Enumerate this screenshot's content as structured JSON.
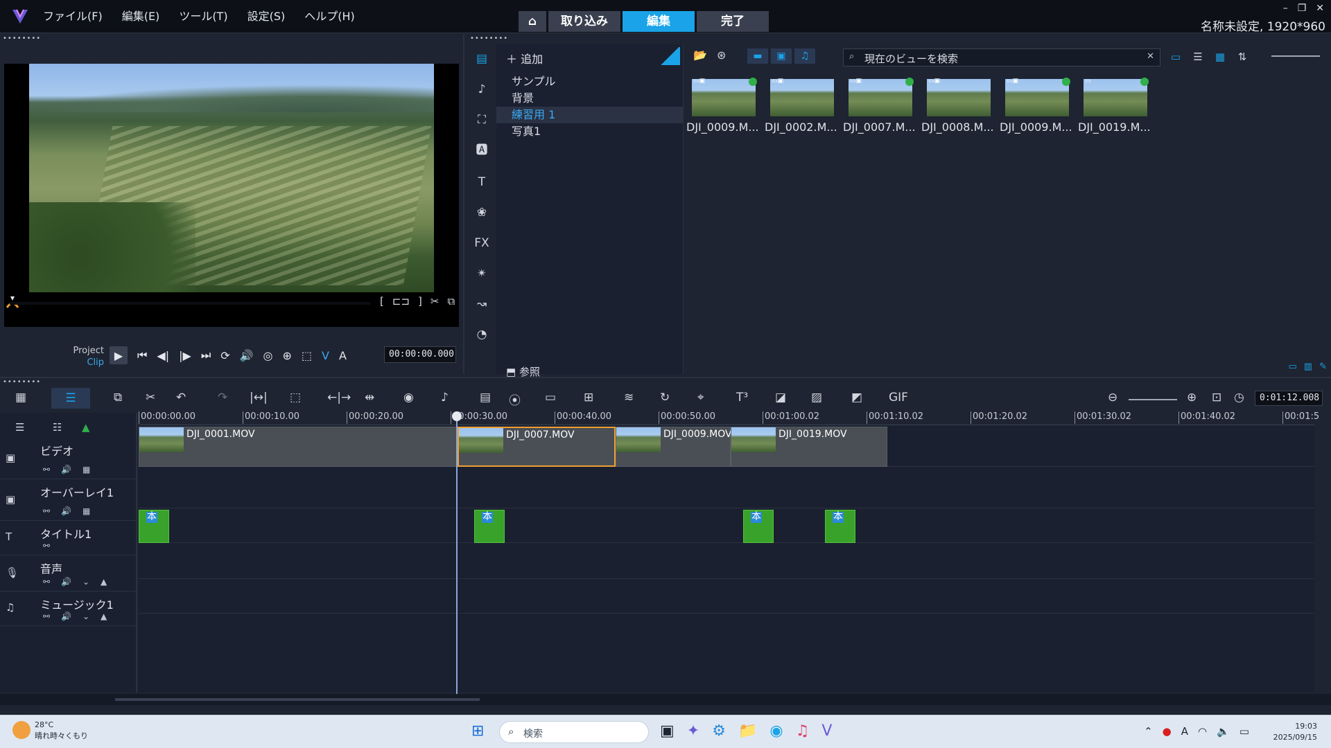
{
  "titlebar": {
    "menu": [
      "ファイル(F)",
      "編集(E)",
      "ツール(T)",
      "設定(S)",
      "ヘルプ(H)"
    ],
    "modes": {
      "capture": "取り込み",
      "edit": "編集",
      "share": "完了"
    },
    "project": "名称未設定, 1920*960",
    "win_minimize": "–",
    "win_restore": "❐",
    "win_close": "✕"
  },
  "player": {
    "project_label": "Project",
    "clip_label": "Clip",
    "timecode": "00:00:00.000"
  },
  "library": {
    "add_label": "追加",
    "tree": [
      "サンプル",
      "背景",
      "練習用 1",
      "写真1"
    ],
    "browse_label": "参照",
    "search_placeholder": "現在のビューを検索",
    "thumbs": [
      {
        "name": "DJI_0009.M...",
        "checked": true
      },
      {
        "name": "DJI_0002.M...",
        "checked": false
      },
      {
        "name": "DJI_0007.M...",
        "checked": true
      },
      {
        "name": "DJI_0008.M...",
        "checked": false
      },
      {
        "name": "DJI_0009.M...",
        "checked": true
      },
      {
        "name": "DJI_0019.M...",
        "checked": true
      }
    ]
  },
  "timeline": {
    "timecode": "0:01:12.008",
    "ruler": [
      "00:00:00.00",
      "00:00:10.00",
      "00:00:20.00",
      "00:00:30.00",
      "00:00:40.00",
      "00:00:50.00",
      "00:01:00.02",
      "00:01:10.02",
      "00:01:20.02",
      "00:01:30.02",
      "00:01:40.02",
      "00:01:5"
    ],
    "tracks": [
      {
        "name": "ビデオ"
      },
      {
        "name": "オーバーレイ1"
      },
      {
        "name": "タイトル1"
      },
      {
        "name": "音声"
      },
      {
        "name": "ミュージック1"
      }
    ],
    "video_clips": [
      "DJI_0001.MOV",
      "DJI_0007.MOV",
      "DJI_0009.MOV",
      "DJI_0019.MOV"
    ],
    "title_clip_label": "本"
  },
  "taskbar": {
    "temp": "28°C",
    "weather": "晴れ時々くもり",
    "search": "検索",
    "time": "19:03",
    "date": "2025/09/15"
  }
}
